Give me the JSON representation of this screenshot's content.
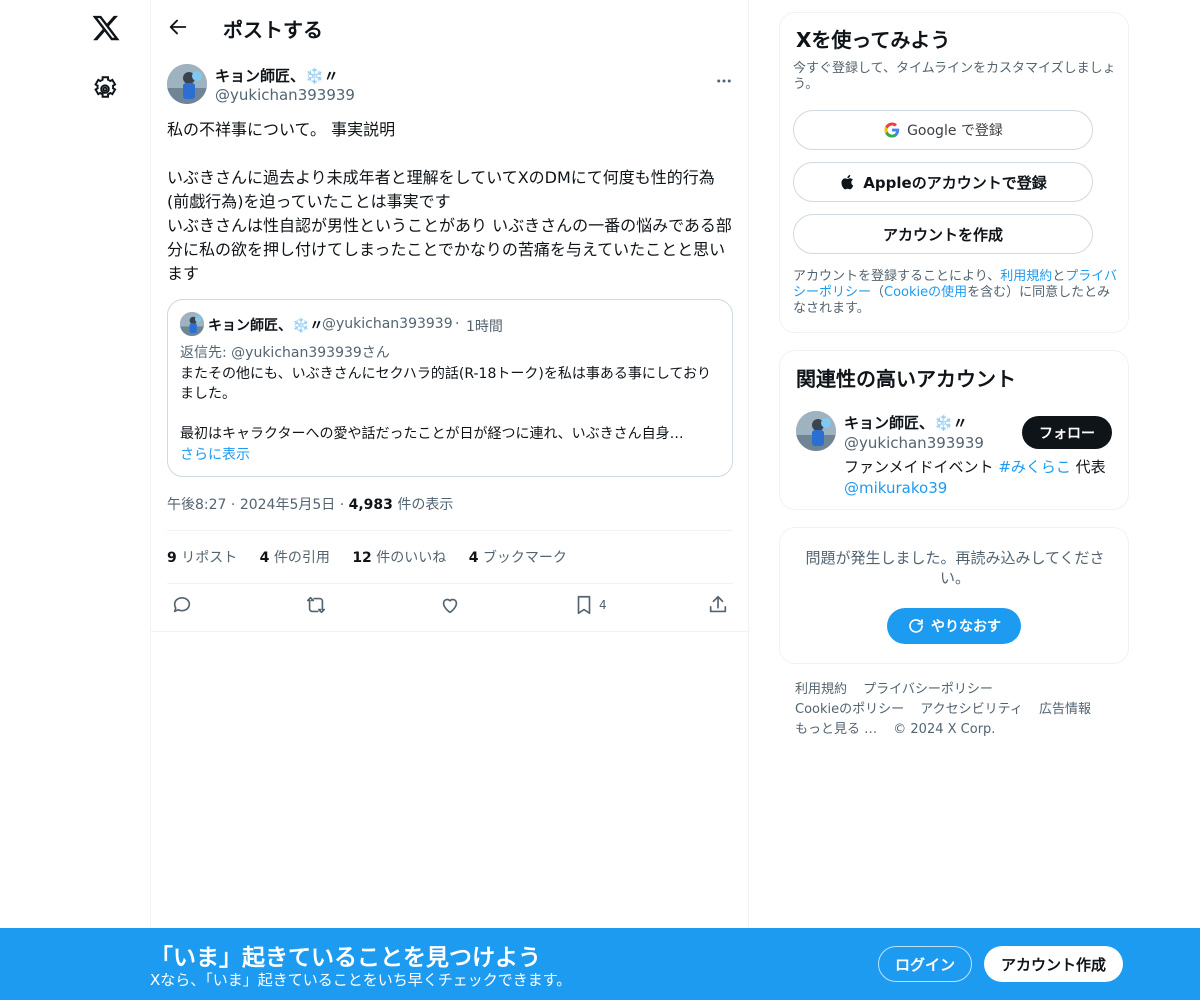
{
  "header": {
    "title": "ポストする"
  },
  "post": {
    "author_name": "キョン師匠、❄️〃",
    "author_handle": "@yukichan393939",
    "text": "私の不祥事について。 事実説明\n\nいぶきさんに過去より未成年者と理解をしていてXのDMにて何度も性的行為(前戯行為)を迫っていたことは事実です\nいぶきさんは性自認が男性ということがあり いぶきさんの一番の悩みである部分に私の欲を押し付けてしまったことでかなりの苦痛を与えていたことと思います",
    "quote": {
      "author_name": "キョン師匠、❄️〃",
      "author_handle": "@yukichan393939",
      "time": "1時間",
      "reply_to": "返信先: @yukichan393939さん",
      "text": "またその他にも、いぶきさんにセクハラ的話(R-18トーク)を私は事ある事にしておりました。\n\n最初はキャラクターへの愛や話だったことが日が経つに連れ、いぶきさん自身…",
      "show_more": "さらに表示"
    },
    "time": "午後8:27",
    "date": "2024年5月5日",
    "views_count": "4,983",
    "views_label": "件の表示",
    "stats": [
      {
        "count": "9",
        "label": "リポスト"
      },
      {
        "count": "4",
        "label": "件の引用"
      },
      {
        "count": "12",
        "label": "件のいいね"
      },
      {
        "count": "4",
        "label": "ブックマーク"
      }
    ],
    "bookmark_count": "4"
  },
  "signup_card": {
    "title": "Xを使ってみよう",
    "subtitle": "今すぐ登録して、タイムラインをカスタマイズしましょう。",
    "google_label": "Google で登録",
    "apple_label": "Appleのアカウントで登録",
    "create_label": "アカウントを作成",
    "legal_1": "アカウントを登録することにより、",
    "legal_terms": "利用規約",
    "legal_and": "と",
    "legal_privacy": "プライバシーポリシー",
    "legal_paren_open": "（",
    "legal_cookie": "Cookieの使用",
    "legal_2": "を含む）に同意したとみなされます。"
  },
  "related": {
    "title": "関連性の高いアカウント",
    "name": "キョン師匠、❄️〃",
    "handle": "@yukichan393939",
    "bio_1": "ファンメイドイベント ",
    "bio_tag": "#みくらこ",
    "bio_2": " 代表 ",
    "bio_mention": "@mikurako39",
    "follow_label": "フォロー"
  },
  "error_card": {
    "message": "問題が発生しました。再読み込みしてください。",
    "retry_label": "やりなおす"
  },
  "footer": {
    "links": [
      "利用規約",
      "プライバシーポリシー",
      "Cookieのポリシー",
      "アクセシビリティ",
      "広告情報",
      "もっと見る …"
    ],
    "copyright": "© 2024 X Corp."
  },
  "banner": {
    "title": "「いま」起きていることを見つけよう",
    "subtitle": "Xなら、「いま」起きていることをいち早くチェックできます。",
    "login_label": "ログイン",
    "signup_label": "アカウント作成"
  },
  "colors": {
    "accent": "#1d9bf0",
    "text": "#0f1419",
    "muted": "#536471",
    "border": "#eff3f4"
  }
}
